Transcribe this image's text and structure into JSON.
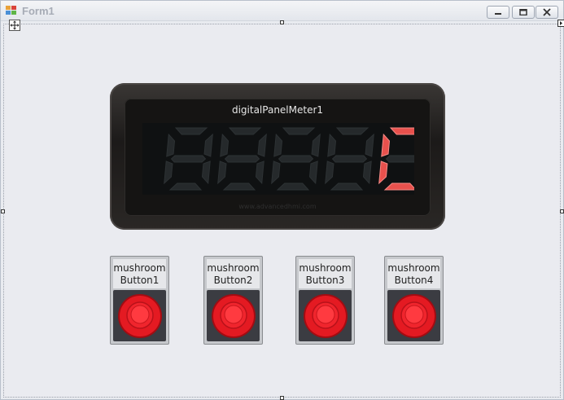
{
  "window": {
    "title": "Form1",
    "icon": "form-app-icon",
    "controls": [
      "minimize-icon",
      "maximize-icon",
      "close-icon"
    ]
  },
  "meter": {
    "name": "digitalPanelMeter1",
    "value": "0",
    "digit_count": 5,
    "watermark": "www.advancedhmi.com",
    "colors": {
      "active_segment": "#e8514d",
      "inactive_segment": "#25292b",
      "bezel": "#2c2927"
    }
  },
  "buttons": [
    {
      "label": "mushroomButton1",
      "color": "#e01b24"
    },
    {
      "label": "mushroomButton2",
      "color": "#e01b24"
    },
    {
      "label": "mushroomButton3",
      "color": "#e01b24"
    },
    {
      "label": "mushroomButton4",
      "color": "#e01b24"
    }
  ]
}
